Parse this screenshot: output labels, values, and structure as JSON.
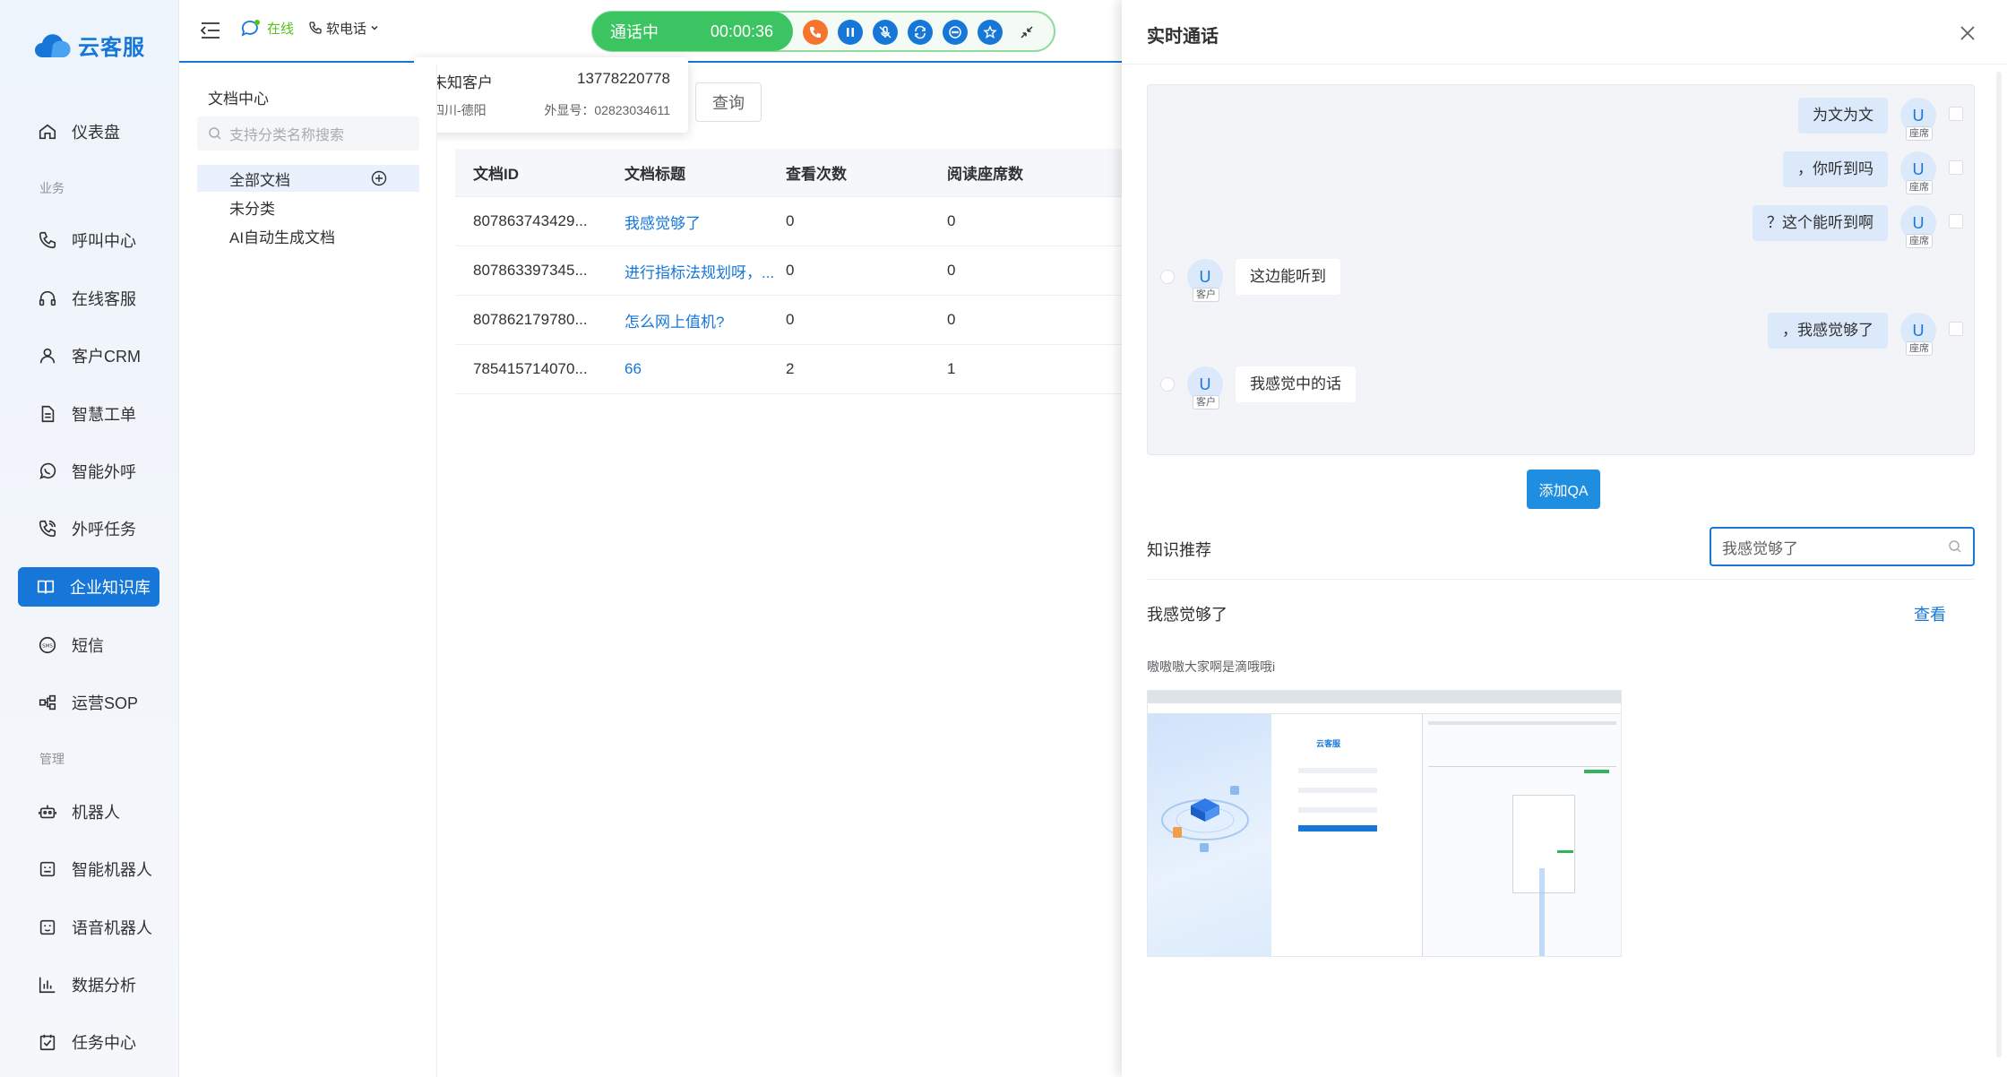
{
  "app": {
    "logo_text": "云客服"
  },
  "sidebar": {
    "items": [
      {
        "label": "仪表盘",
        "icon": "home-icon"
      },
      {
        "label": "呼叫中心",
        "icon": "phone-icon"
      },
      {
        "label": "在线客服",
        "icon": "headset-icon"
      },
      {
        "label": "客户CRM",
        "icon": "user-icon"
      },
      {
        "label": "智慧工单",
        "icon": "document-icon"
      },
      {
        "label": "智能外呼",
        "icon": "whatsapp-icon"
      },
      {
        "label": "外呼任务",
        "icon": "phone-call-icon"
      },
      {
        "label": "企业知识库",
        "icon": "book-icon"
      },
      {
        "label": "短信",
        "icon": "sms-icon"
      },
      {
        "label": "运营SOP",
        "icon": "flow-icon"
      },
      {
        "label": "机器人",
        "icon": "robot-icon"
      },
      {
        "label": "智能机器人",
        "icon": "bot-icon"
      },
      {
        "label": "语音机器人",
        "icon": "voice-bot-icon"
      },
      {
        "label": "数据分析",
        "icon": "bar-chart-icon"
      },
      {
        "label": "任务中心",
        "icon": "task-icon"
      }
    ],
    "sections": {
      "business": "业务",
      "manage": "管理"
    }
  },
  "topbar": {
    "status": "在线",
    "phone_mode": "软电话"
  },
  "call": {
    "state": "通话中",
    "timer": "00:00:36",
    "caller_name": "未知客户",
    "caller_number": "13778220778",
    "location": "四川-德阳",
    "display_number": "外显号：02823034611"
  },
  "doc_panel": {
    "title": "文档中心",
    "search_placeholder": "支持分类名称搜索",
    "tree": [
      "全部文档",
      "未分类",
      "AI自动生成文档"
    ]
  },
  "query_label": "查询",
  "table": {
    "headers": [
      "文档ID",
      "文档标题",
      "查看次数",
      "阅读座席数"
    ],
    "rows": [
      {
        "id": "807863743429...",
        "title": "我感觉够了",
        "views": "0",
        "readers": "0"
      },
      {
        "id": "807863397345...",
        "title": "进行指标法规划呀，...",
        "views": "0",
        "readers": "0"
      },
      {
        "id": "807862179780...",
        "title": "怎么网上值机?",
        "views": "0",
        "readers": "0"
      },
      {
        "id": "785415714070...",
        "title": "66",
        "views": "2",
        "readers": "1"
      }
    ]
  },
  "drawer": {
    "title": "实时通话",
    "messages": [
      {
        "side": "agent",
        "text": "为文为文",
        "avatar": "U",
        "tag": "座席"
      },
      {
        "side": "agent",
        "text": "，你听到吗",
        "avatar": "U",
        "tag": "座席"
      },
      {
        "side": "agent",
        "text": "？这个能听到啊",
        "avatar": "U",
        "tag": "座席"
      },
      {
        "side": "customer",
        "text": "这边能听到",
        "avatar": "U",
        "tag": "客户"
      },
      {
        "side": "agent",
        "text": "，我感觉够了",
        "avatar": "U",
        "tag": "座席"
      },
      {
        "side": "customer",
        "text": "我感觉中的话",
        "avatar": "U",
        "tag": "客户"
      }
    ],
    "add_qa": "添加QA",
    "knowledge_label": "知识推荐",
    "knowledge_query": "我感觉够了",
    "result_title": "我感觉够了",
    "result_view": "查看",
    "result_desc": "嗷嗷嗷大家啊是滴哦哦i",
    "thumb_logo": "云客服"
  },
  "colors": {
    "primary": "#1677d9",
    "call_green": "#3cc463",
    "hangup_orange": "#f5752f",
    "online_green": "#52c41a"
  }
}
